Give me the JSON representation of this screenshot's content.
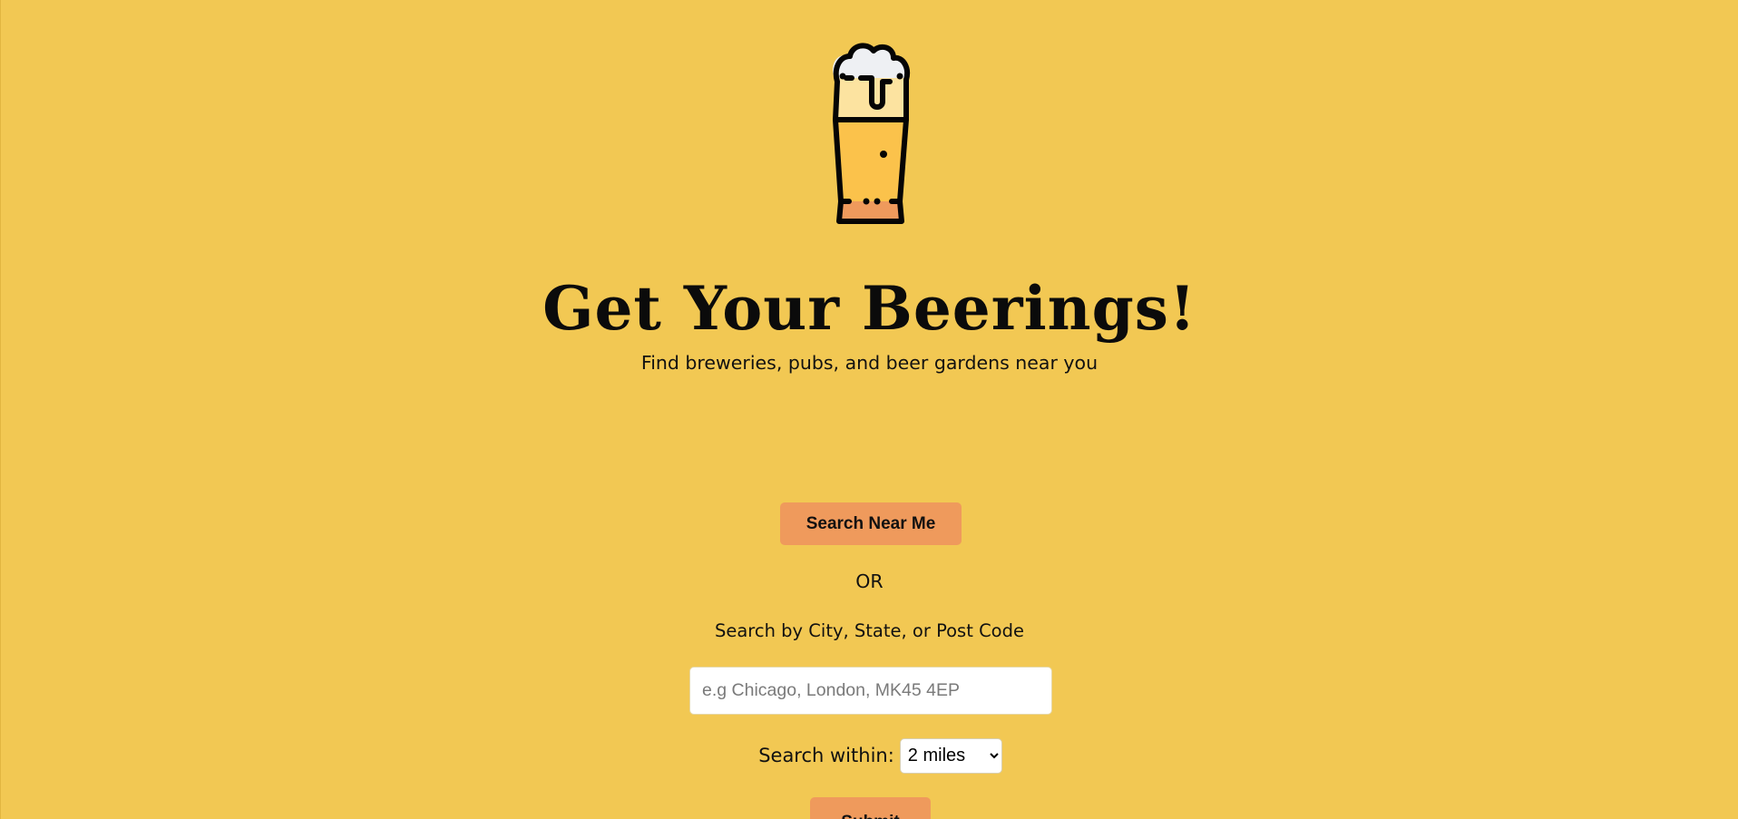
{
  "header": {
    "logo_icon": "beer-glass-icon",
    "title": "Get Your Beerings!",
    "subtitle": "Find breweries, pubs, and beer gardens near you"
  },
  "search": {
    "near_me_label": "Search Near Me",
    "or_text": "OR",
    "city_label": "Search by City, State, or Post Code",
    "city_placeholder": "e.g Chicago, London, MK45 4EP",
    "within_label": "Search within:",
    "within_selected": "2 miles",
    "submit_label": "Submit"
  },
  "colors": {
    "background": "#f2c853",
    "button": "#ef9a5c",
    "text": "#111111"
  }
}
